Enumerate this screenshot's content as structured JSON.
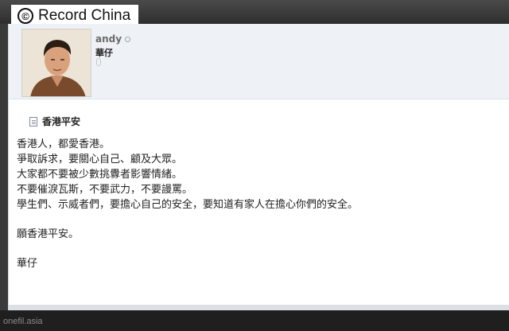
{
  "watermark": {
    "symbol": "©",
    "text": "Record China"
  },
  "profile": {
    "username": "andy",
    "alias": "華仔"
  },
  "post": {
    "title": "香港平安",
    "lines": [
      "香港人，都愛香港。",
      "爭取訴求，要關心自己、顧及大眾。",
      "大家都不要被少數挑釁者影響情緒。",
      "不要催淚瓦斯，不要武力，不要謾罵。",
      "學生們、示威者們，要擔心自己的安全，要知道有家人在擔心你們的安全。",
      "願香港平安。",
      "華仔"
    ]
  },
  "source": "onefil.asia",
  "icons": [
    "copyright-icon",
    "status-dot-icon",
    "gender-icon",
    "document-icon"
  ]
}
